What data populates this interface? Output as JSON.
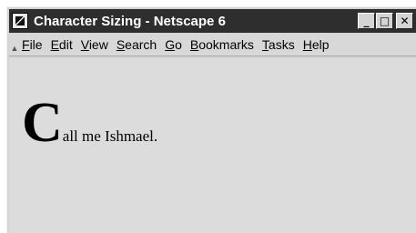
{
  "window": {
    "title": "Character Sizing - Netscape 6",
    "buttons": {
      "minimize": "_",
      "maximize": "□",
      "close": "✕"
    }
  },
  "menubar": {
    "items": [
      {
        "label": "File",
        "accel": "F"
      },
      {
        "label": "Edit",
        "accel": "E"
      },
      {
        "label": "View",
        "accel": "V"
      },
      {
        "label": "Search",
        "accel": "S"
      },
      {
        "label": "Go",
        "accel": "G"
      },
      {
        "label": "Bookmarks",
        "accel": "B"
      },
      {
        "label": "Tasks",
        "accel": "T"
      },
      {
        "label": "Help",
        "accel": "H"
      }
    ]
  },
  "page": {
    "drop_cap": "C",
    "text": "all me Ishmael."
  }
}
